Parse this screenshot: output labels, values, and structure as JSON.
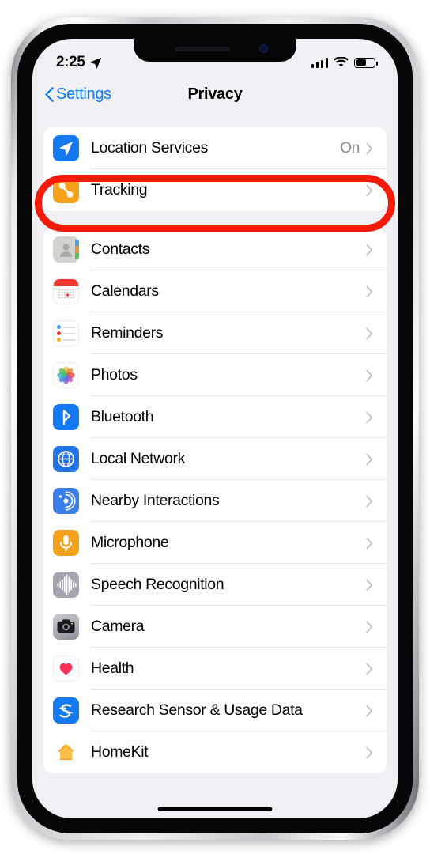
{
  "status_bar": {
    "time": "2:25",
    "location_arrow_icon": "location-arrow-icon",
    "cellular_icon": "cellular-bars-icon",
    "wifi_icon": "wifi-icon",
    "battery_icon": "battery-icon"
  },
  "nav": {
    "back_label": "Settings",
    "title": "Privacy",
    "back_chevron_icon": "chevron-left-icon",
    "accent_color": "#0a7cff"
  },
  "annotation": {
    "shape": "oval",
    "color": "#f41b08",
    "target": "Location Services"
  },
  "groups": [
    {
      "name": "primary",
      "rows": [
        {
          "label": "Location Services",
          "value": "On",
          "icon": "location-arrow-icon",
          "icon_class": "ic-location"
        },
        {
          "label": "Tracking",
          "value": "",
          "icon": "tracking-icon",
          "icon_class": "ic-tracking"
        }
      ]
    },
    {
      "name": "permissions",
      "rows": [
        {
          "label": "Contacts",
          "value": "",
          "icon": "contacts-icon",
          "icon_class": "ic-contacts"
        },
        {
          "label": "Calendars",
          "value": "",
          "icon": "calendar-icon",
          "icon_class": "ic-calendar"
        },
        {
          "label": "Reminders",
          "value": "",
          "icon": "reminders-icon",
          "icon_class": "ic-reminders"
        },
        {
          "label": "Photos",
          "value": "",
          "icon": "photos-icon",
          "icon_class": "ic-photos"
        },
        {
          "label": "Bluetooth",
          "value": "",
          "icon": "bluetooth-icon",
          "icon_class": "ic-bluetooth"
        },
        {
          "label": "Local Network",
          "value": "",
          "icon": "globe-icon",
          "icon_class": "ic-network"
        },
        {
          "label": "Nearby Interactions",
          "value": "",
          "icon": "nearby-interactions-icon",
          "icon_class": "ic-nearby"
        },
        {
          "label": "Microphone",
          "value": "",
          "icon": "microphone-icon",
          "icon_class": "ic-mic"
        },
        {
          "label": "Speech Recognition",
          "value": "",
          "icon": "waveform-icon",
          "icon_class": "ic-speech"
        },
        {
          "label": "Camera",
          "value": "",
          "icon": "camera-icon",
          "icon_class": "ic-camera"
        },
        {
          "label": "Health",
          "value": "",
          "icon": "heart-icon",
          "icon_class": "ic-health"
        },
        {
          "label": "Research Sensor & Usage Data",
          "value": "",
          "icon": "research-sensor-icon",
          "icon_class": "ic-research"
        },
        {
          "label": "HomeKit",
          "value": "",
          "icon": "homekit-icon",
          "icon_class": "ic-homekit"
        }
      ]
    }
  ]
}
